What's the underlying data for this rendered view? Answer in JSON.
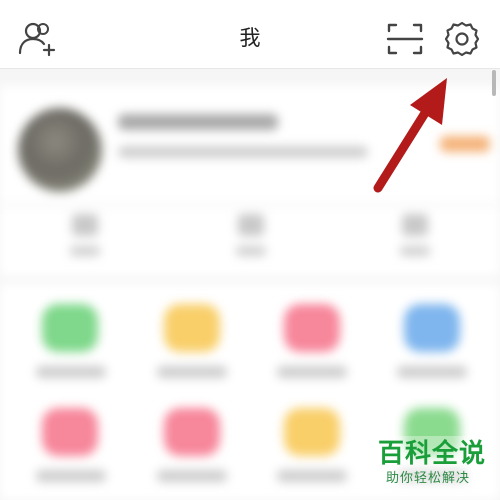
{
  "header": {
    "title": "我",
    "icons": [
      "add-friend-icon",
      "scan-icon",
      "settings-gear-icon"
    ]
  },
  "annotation": {
    "arrow_color": "#b31b1b",
    "points_to": "settings-gear-icon"
  },
  "watermark": {
    "main_text": "百科全说",
    "sub_text": "助你轻松解决",
    "color": "#1a9e3a"
  },
  "colors": {
    "header_bg": "#ffffff",
    "page_bg": "#f6f6f6",
    "grid_icon_colors": [
      "#7fd88b",
      "#f9cf6a",
      "#f7879b",
      "#7fb6ee",
      "#f7879b",
      "#f7879b",
      "#f9cf6a",
      "#8bdb8f"
    ]
  }
}
